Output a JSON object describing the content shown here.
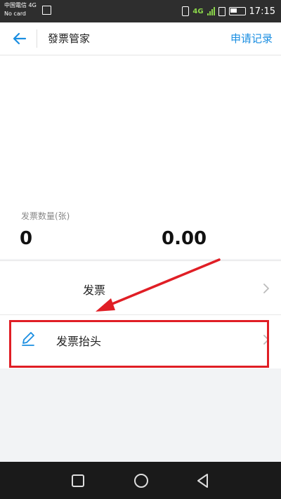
{
  "status_bar": {
    "carrier_line1": "中国電信 4G",
    "carrier_line2": "No card",
    "network": "4G",
    "time": "17:15"
  },
  "header": {
    "title": "發票管家",
    "right_link": "申请记录",
    "accent_color": "#1a8ee1"
  },
  "summary": {
    "count_label": "发票数量(张)",
    "count_value": "0",
    "amount_value": "0.00"
  },
  "list": {
    "invoice_label": "发票",
    "header_label": "发票抬头"
  },
  "annotation": {
    "highlight_color": "#e01e25"
  }
}
